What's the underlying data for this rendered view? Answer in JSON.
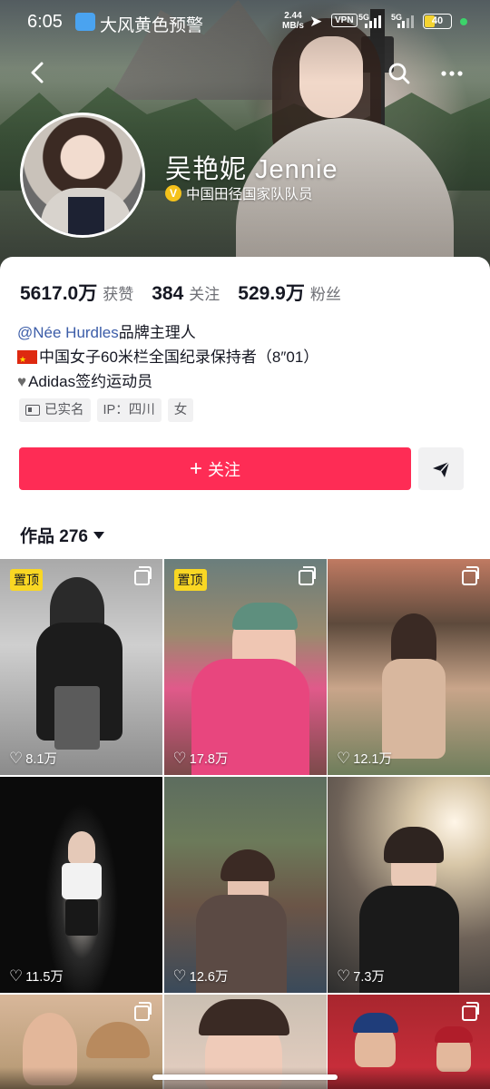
{
  "status_bar": {
    "time": "6:05",
    "notification": "大风黄色预警",
    "net_speed_value": "2.44",
    "net_speed_unit": "MB/s",
    "vpn": "VPN",
    "signal_1": "5G",
    "signal_2": "5G",
    "battery": "40",
    "battery_color": "#f5d431"
  },
  "profile": {
    "name": "吴艳妮 Jennie",
    "verification": "中国田径国家队队员",
    "verify_badge": "V",
    "verify_color": "#f5c21b",
    "stats": [
      {
        "value": "5617.0万",
        "label": "获赞"
      },
      {
        "value": "384",
        "label": "关注"
      },
      {
        "value": "529.9万",
        "label": "粉丝"
      }
    ],
    "bio": {
      "mention": "@Née Hurdles",
      "mention_suffix": " 品牌主理人",
      "line2": "中国女子60米栏全国纪录保持者（8″01）",
      "line3": "Adidas签约运动员"
    },
    "tags": {
      "verified": "已实名",
      "ip": "IP：四川",
      "gender": "女"
    }
  },
  "actions": {
    "follow": "关注",
    "follow_color": "#fe2c55"
  },
  "works": {
    "label": "作品 276",
    "pin_label": "置顶",
    "items": [
      {
        "likes": "8.1万",
        "pinned": true
      },
      {
        "likes": "17.8万",
        "pinned": true
      },
      {
        "likes": "12.1万",
        "pinned": false
      },
      {
        "likes": "11.5万",
        "pinned": false
      },
      {
        "likes": "12.6万",
        "pinned": false
      },
      {
        "likes": "7.3万",
        "pinned": false
      }
    ]
  },
  "icons": {
    "back": "back-arrow-icon",
    "search": "search-icon",
    "more": "more-icon",
    "share": "share-arrow-icon",
    "heart": "heart-outline-icon",
    "multi": "multi-image-icon"
  }
}
